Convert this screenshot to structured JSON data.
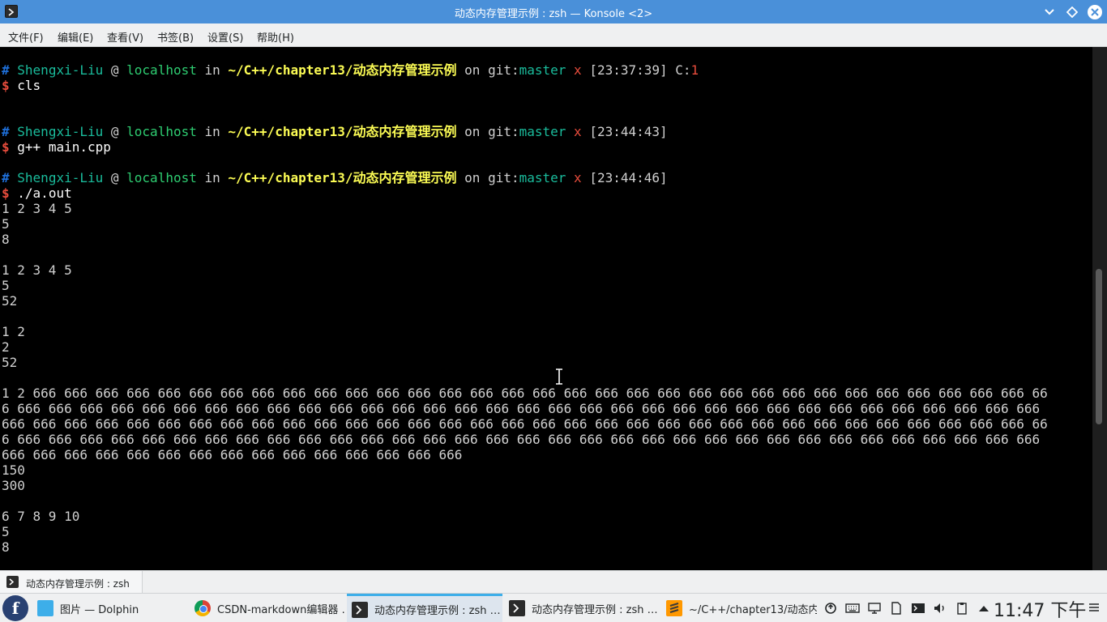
{
  "window": {
    "title": "动态内存管理示例 : zsh — Konsole <2>"
  },
  "menu": {
    "file": "文件(F)",
    "edit": "编辑(E)",
    "view": "查看(V)",
    "bookmarks": "书签(B)",
    "settings": "设置(S)",
    "help": "帮助(H)"
  },
  "terminal": {
    "prompts": [
      {
        "user": "Shengxi-Liu",
        "host": "localhost",
        "dir": "~/C++/chapter13/动态内存管理示例",
        "branch": "master",
        "dirty": "x",
        "time": "[23:37:39]",
        "code_label": " C:",
        "code": "1",
        "command": "cls"
      },
      {
        "user": "Shengxi-Liu",
        "host": "localhost",
        "dir": "~/C++/chapter13/动态内存管理示例",
        "branch": "master",
        "dirty": "x",
        "time": "[23:44:43]",
        "command": "g++ main.cpp"
      },
      {
        "user": "Shengxi-Liu",
        "host": "localhost",
        "dir": "~/C++/chapter13/动态内存管理示例",
        "branch": "master",
        "dirty": "x",
        "time": "[23:44:46]",
        "command": "./a.out"
      }
    ],
    "output": [
      "1 2 3 4 5",
      "5",
      "8",
      "",
      "1 2 3 4 5",
      "5",
      "52",
      "",
      "1 2",
      "2",
      "52",
      "",
      "1 2 666 666 666 666 666 666 666 666 666 666 666 666 666 666 666 666 666 666 666 666 666 666 666 666 666 666 666 666 666 666 666 666 66",
      "6 666 666 666 666 666 666 666 666 666 666 666 666 666 666 666 666 666 666 666 666 666 666 666 666 666 666 666 666 666 666 666 666 666",
      "666 666 666 666 666 666 666 666 666 666 666 666 666 666 666 666 666 666 666 666 666 666 666 666 666 666 666 666 666 666 666 666 666 66",
      "6 666 666 666 666 666 666 666 666 666 666 666 666 666 666 666 666 666 666 666 666 666 666 666 666 666 666 666 666 666 666 666 666 666",
      "666 666 666 666 666 666 666 666 666 666 666 666 666 666 666",
      "150",
      "300",
      "",
      "6 7 8 9 10",
      "5",
      "8"
    ]
  },
  "tabs": [
    {
      "label": "动态内存管理示例 : zsh"
    }
  ],
  "taskbar": {
    "launcher_glyph": "f",
    "tasks": [
      {
        "label": "图片 — Dolphin",
        "icon": "folder-icon"
      },
      {
        "label": "CSDN-markdown编辑器 …",
        "icon": "chrome-icon"
      },
      {
        "label": "动态内存管理示例 : zsh …",
        "icon": "terminal-icon",
        "active": true
      },
      {
        "label": "动态内存管理示例 : zsh …",
        "icon": "terminal-icon"
      },
      {
        "label": "~/C++/chapter13/动态内…",
        "icon": "sublime-icon"
      }
    ],
    "clock": "11:47 下午"
  },
  "colors": {
    "titlebar": "#4a90d9",
    "accent": "#3daee9",
    "terminal_bg": "#000000"
  }
}
